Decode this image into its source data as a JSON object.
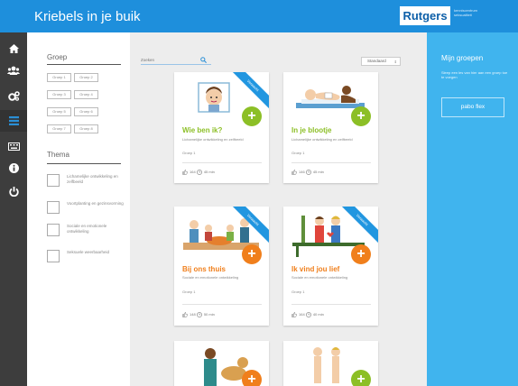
{
  "app": {
    "title": "Kriebels in je buik"
  },
  "brand": {
    "name": "Rutgers",
    "tagline": "kenniscentrum seksualiteit"
  },
  "rail": {
    "items": [
      {
        "icon": "home-icon"
      },
      {
        "icon": "users-icon"
      },
      {
        "icon": "gears-icon"
      },
      {
        "icon": "grid-icon"
      },
      {
        "icon": "keyboard-icon"
      },
      {
        "icon": "info-icon"
      },
      {
        "icon": "power-icon"
      }
    ]
  },
  "filters": {
    "groep_heading": "Groep",
    "groups": [
      "Groep 1",
      "Groep 2",
      "Groep 3",
      "Groep 4",
      "Groep 5",
      "Groep 6",
      "Groep 7",
      "Groep 8"
    ],
    "thema_heading": "Thema",
    "themes": [
      "Lichamelijke ontwikkeling en zelfbeeld",
      "Voortplanting en gezinsvorming",
      "Sociale en emotionele ontwikkeling",
      "Seksuele weerbaarheid"
    ]
  },
  "toolbar": {
    "search_placeholder": "Zoeken",
    "sort_value": "Standaard"
  },
  "cards": [
    {
      "title": "Wie ben ik?",
      "desc": "Lichamelijke ontwikkeling en zelfbeeld",
      "grade": "Groep 1",
      "likes": "164",
      "duration": "45 min",
      "ribbon": "Verwacht",
      "color": "#8cbf26"
    },
    {
      "title": "In je blootje",
      "desc": "Lichamelijke ontwikkeling en zelfbeeld",
      "grade": "Groep 1",
      "likes": "146",
      "duration": "45 min",
      "ribbon": "",
      "color": "#8cbf26"
    },
    {
      "title": "Bij ons thuis",
      "desc": "Sociale en emotionele ontwikkeling",
      "grade": "Groep 1",
      "likes": "148",
      "duration": "50 min",
      "ribbon": "Verwacht",
      "color": "#f07f1c"
    },
    {
      "title": "Ik vind jou lief",
      "desc": "Sociale en emotionele ontwikkeling",
      "grade": "Groep 1",
      "likes": "164",
      "duration": "40 min",
      "ribbon": "Verwacht",
      "color": "#f07f1c"
    },
    {
      "title": "",
      "desc": "",
      "grade": "",
      "likes": "",
      "duration": "",
      "ribbon": "",
      "color": "#f07f1c"
    },
    {
      "title": "",
      "desc": "",
      "grade": "",
      "likes": "",
      "duration": "",
      "ribbon": "",
      "color": "#8cbf26"
    }
  ],
  "groups_panel": {
    "title": "Mijn groepen",
    "text": "Sleep een les van hier aan een groep toe te voegen",
    "button": "pabo flex"
  },
  "colors": {
    "topbar": "#1e8fdc",
    "rail": "#3d3d3d",
    "panel": "#40b4ee",
    "green": "#8cbf26",
    "orange": "#f07f1c"
  }
}
